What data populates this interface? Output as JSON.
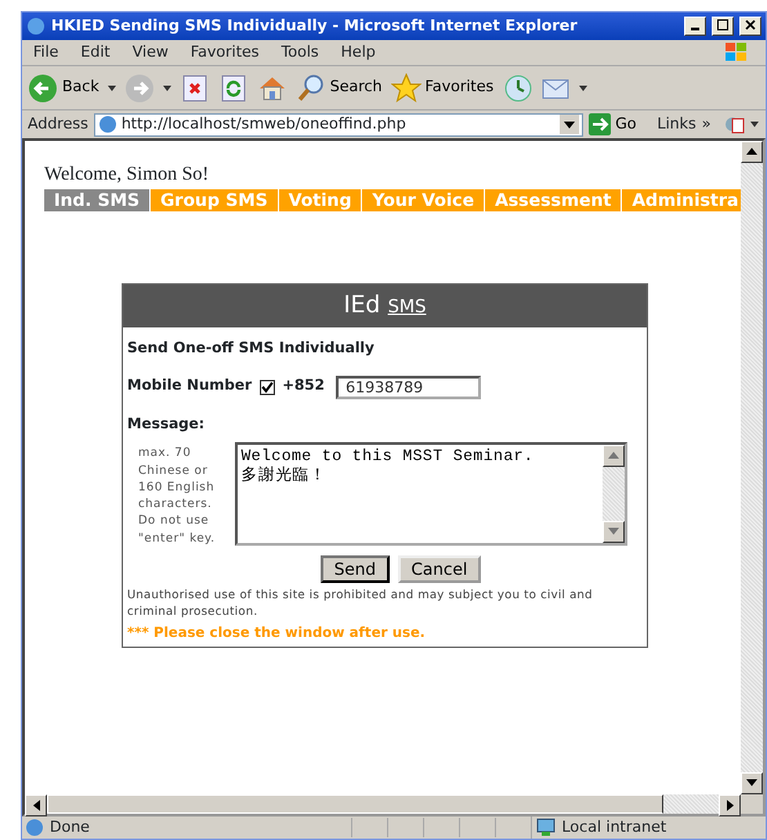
{
  "window": {
    "title": "HKIED Sending SMS Individually - Microsoft Internet Explorer"
  },
  "menu": [
    "File",
    "Edit",
    "View",
    "Favorites",
    "Tools",
    "Help"
  ],
  "toolbar": [
    {
      "kind": "back",
      "label": "Back"
    },
    {
      "kind": "forward"
    },
    {
      "kind": "stop"
    },
    {
      "kind": "refresh"
    },
    {
      "kind": "home"
    },
    {
      "kind": "search",
      "label": "Search"
    },
    {
      "kind": "favorites",
      "label": "Favorites"
    },
    {
      "kind": "history"
    },
    {
      "kind": "mail"
    }
  ],
  "address_bar": {
    "label": "Address",
    "url": "http://localhost/smweb/oneoffind.php",
    "go": "Go",
    "links": "Links",
    "more": "»"
  },
  "page": {
    "welcome": "Welcome, Simon So!",
    "tabs": [
      {
        "label": "Ind. SMS",
        "selected": true
      },
      {
        "label": "Group SMS",
        "selected": false
      },
      {
        "label": "Voting",
        "selected": false
      },
      {
        "label": "Your Voice",
        "selected": false
      },
      {
        "label": "Assessment",
        "selected": false
      },
      {
        "label": "Administra",
        "selected": false
      }
    ],
    "panel": {
      "brand": "IEd",
      "brand_suffix": "SMS",
      "heading": "Send One-off SMS Individually",
      "mobile_label": "Mobile Number",
      "mobile_checked": true,
      "prefix": "+852",
      "mobile_value": "61938789",
      "message_label": "Message:",
      "hint": "max. 70 Chinese or 160 English characters. Do not use \"enter\" key.",
      "message_value": "Welcome to this MSST Seminar.\n多謝光臨！",
      "buttons": [
        "Send",
        "Cancel"
      ],
      "disclaimer": "Unauthorised use of this site is prohibited and may subject you to civil and criminal prosecution.",
      "notice": "*** Please close the window after use."
    }
  },
  "status_bar": {
    "status": "Done",
    "zone": "Local intranet"
  }
}
